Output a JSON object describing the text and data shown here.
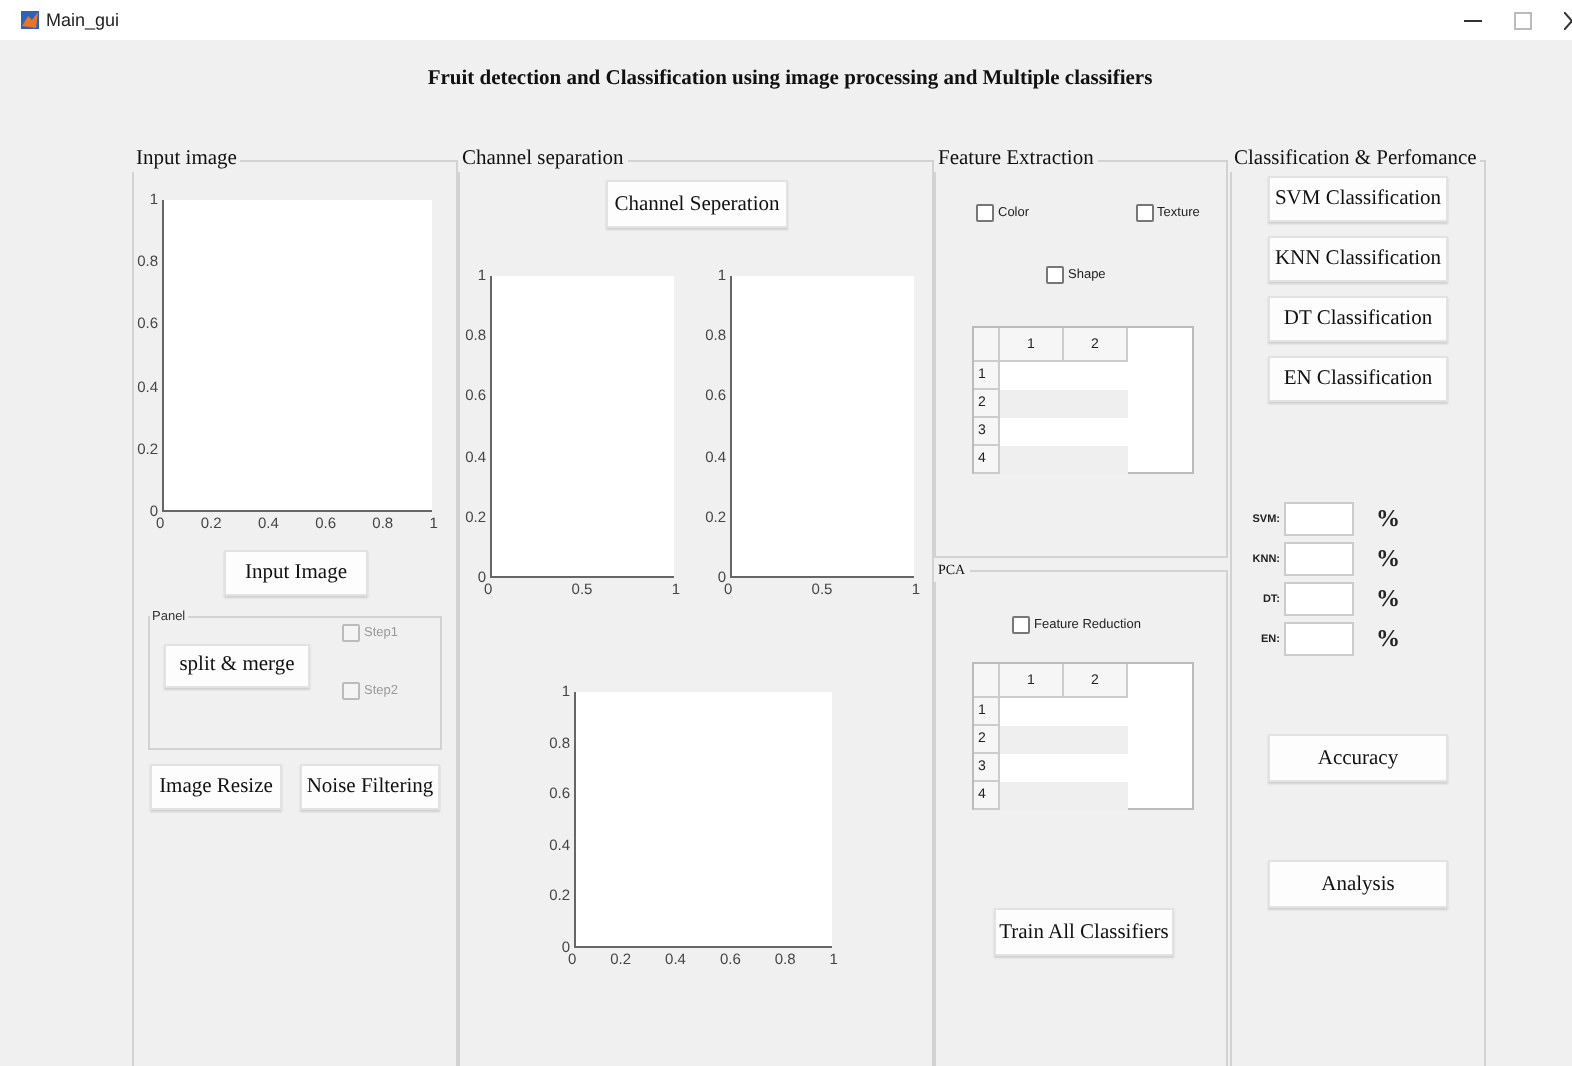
{
  "window": {
    "title": "Main_gui"
  },
  "header": "Fruit detection and Classification using image processing and  Multiple classifiers",
  "input_panel": {
    "title": "Input image",
    "axes": {
      "yticks": [
        "1",
        "0.8",
        "0.6",
        "0.4",
        "0.2",
        "0"
      ],
      "xticks": [
        "0",
        "0.2",
        "0.4",
        "0.6",
        "0.8",
        "1"
      ]
    },
    "button": "Input Image",
    "subpanel": {
      "title": "Panel",
      "button": "split & merge",
      "checkboxes": [
        {
          "label": "Step1",
          "checked": false,
          "disabled": true
        },
        {
          "label": "Step2",
          "checked": false,
          "disabled": true
        }
      ]
    },
    "buttons": [
      "Image Resize",
      "Noise Filtering"
    ]
  },
  "channel_panel": {
    "title": "Channel separation",
    "button": "Channel Seperation",
    "axes": [
      {
        "yticks": [
          "1",
          "0.8",
          "0.6",
          "0.4",
          "0.2",
          "0"
        ],
        "xticks": [
          "0",
          "0.5",
          "1"
        ]
      },
      {
        "yticks": [
          "1",
          "0.8",
          "0.6",
          "0.4",
          "0.2",
          "0"
        ],
        "xticks": [
          "0",
          "0.5",
          "1"
        ]
      },
      {
        "yticks": [
          "1",
          "0.8",
          "0.6",
          "0.4",
          "0.2",
          "0"
        ],
        "xticks": [
          "0",
          "0.2",
          "0.4",
          "0.6",
          "0.8",
          "1"
        ]
      }
    ]
  },
  "feature_panel": {
    "title": "Feature Extraction",
    "checkboxes": [
      {
        "label": "Color",
        "checked": false,
        "disabled": false
      },
      {
        "label": "Texture",
        "checked": false,
        "disabled": false
      },
      {
        "label": "Shape",
        "checked": false,
        "disabled": false
      }
    ],
    "table": {
      "columns": [
        "1",
        "2"
      ],
      "rows": [
        "1",
        "2",
        "3",
        "4"
      ]
    }
  },
  "pca_panel": {
    "title": "PCA",
    "checkbox": {
      "label": "Feature Reduction",
      "checked": false,
      "disabled": false
    },
    "table": {
      "columns": [
        "1",
        "2"
      ],
      "rows": [
        "1",
        "2",
        "3",
        "4"
      ]
    },
    "button": "Train All Classifiers"
  },
  "classification_panel": {
    "title": "Classification & Perfomance",
    "buttons": [
      "SVM Classification",
      "KNN Classification",
      "DT Classification",
      "EN Classification"
    ],
    "results": [
      {
        "label": "SVM:",
        "unit": "%"
      },
      {
        "label": "KNN:",
        "unit": "%"
      },
      {
        "label": "DT:",
        "unit": "%"
      },
      {
        "label": "EN:",
        "unit": "%"
      }
    ],
    "buttons_bottom": [
      "Accuracy",
      "Analysis"
    ]
  }
}
